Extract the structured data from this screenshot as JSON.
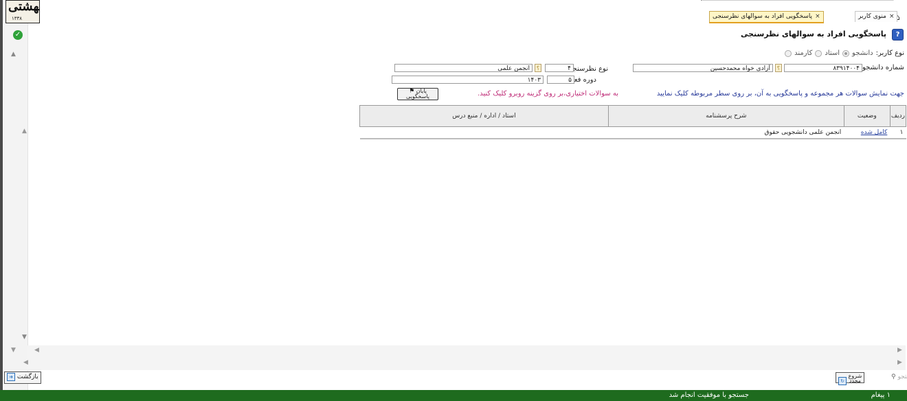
{
  "logo": {
    "text": "بهشتی",
    "year": "۱۳۳۸"
  },
  "tabs": [
    {
      "label": "منوی کاربر",
      "close": "×"
    },
    {
      "label": "پاسخگویی افراد به سوالهای نظرسنجی",
      "close": "×"
    }
  ],
  "page_title": "پاسخگویی افراد به سوالهای نظرسنجی",
  "user_type": {
    "label": "نوع کاربر:",
    "options": [
      "دانشجو",
      "استاد",
      "کارمند"
    ],
    "selected": "دانشجو"
  },
  "form": {
    "student_no_label": "شماره دانشجو",
    "student_no_value": "۸۳۹۱۴۰۰۴",
    "student_name_value": "آزادی خواه محمدحسین",
    "survey_type_label": "نوع نظرسنجی",
    "survey_type_code": "۴",
    "survey_type_name": "انجمن علمی",
    "active_term_label": "دوره فعال",
    "active_term_num": "۵",
    "active_term_year": "۱۴۰۳"
  },
  "hint_main": "جهت نمایش سوالات هر مجموعه و پاسخگویی به آن، بر روی سطر مربوطه کلیک نمایید",
  "hint_optional": "به سوالات اختیاری،بر روی گزینه روبرو کلیک کنید.",
  "finish_button": {
    "line1": "پایان",
    "line2": "پاسخگویی"
  },
  "table": {
    "headers": [
      "ردیف",
      "وضعیت",
      "شرح پرسشنامه",
      "استاد / اداره / منبع درس"
    ],
    "rows": [
      {
        "num": "۱",
        "status": "کامل شده",
        "desc": "انجمن علمی دانشجویی حقوق",
        "source": ""
      }
    ]
  },
  "buttons": {
    "back": "بازگشت",
    "search": "جستجو",
    "restart_line1": "شروع",
    "restart_line2": "مجدد"
  },
  "status_bar": {
    "count": "۱ پیغام",
    "message": "جستجو با موفقیت انجام شد"
  },
  "colors": {
    "status_bar": "#1e6b1e",
    "link": "#2a44a0",
    "hint_pink": "#c0307a"
  }
}
